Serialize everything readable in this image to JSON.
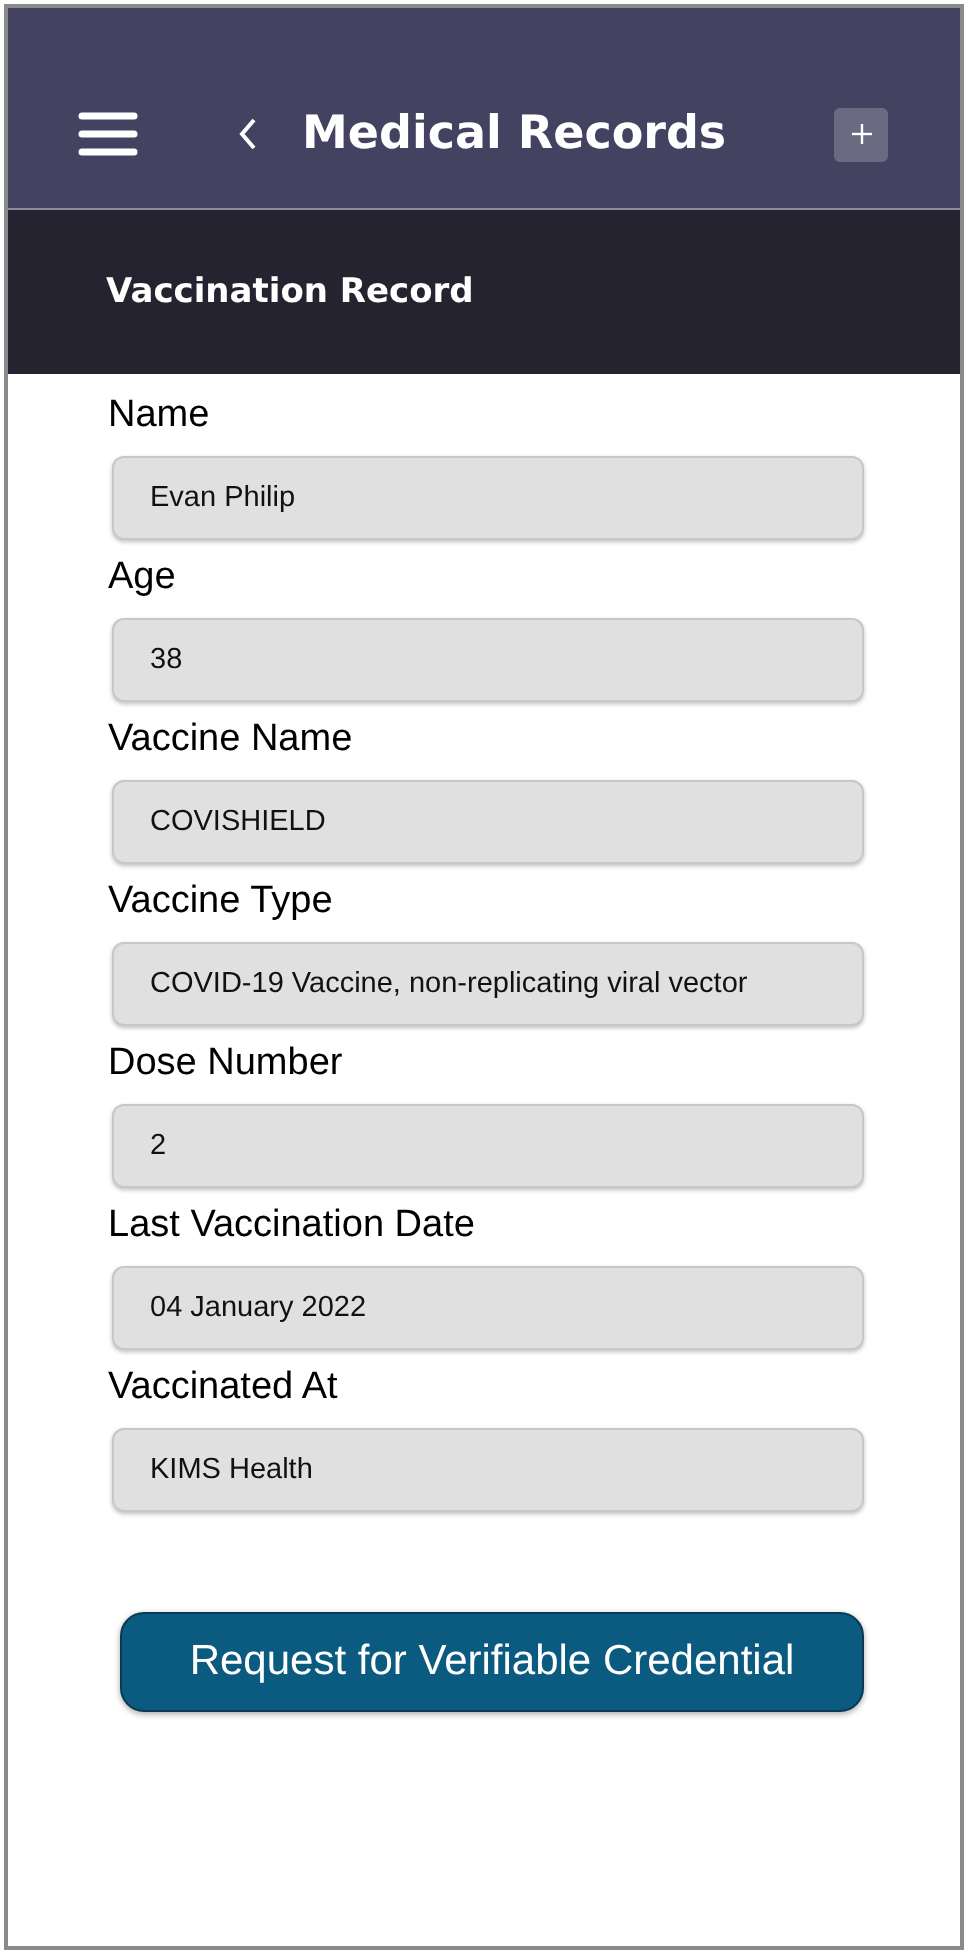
{
  "app_bar": {
    "title": "Medical Records"
  },
  "section": {
    "title": "Vaccination Record"
  },
  "fields": [
    {
      "label": "Name",
      "value": "Evan Philip"
    },
    {
      "label": "Age",
      "value": "38"
    },
    {
      "label": "Vaccine Name",
      "value": "COVISHIELD"
    },
    {
      "label": "Vaccine Type",
      "value": "COVID-19 Vaccine, non-replicating viral vector"
    },
    {
      "label": "Dose Number",
      "value": "2"
    },
    {
      "label": "Last Vaccination Date",
      "value": "04 January 2022"
    },
    {
      "label": "Vaccinated At",
      "value": "KIMS Health"
    }
  ],
  "button": {
    "label": "Request for Verifiable Credential"
  }
}
